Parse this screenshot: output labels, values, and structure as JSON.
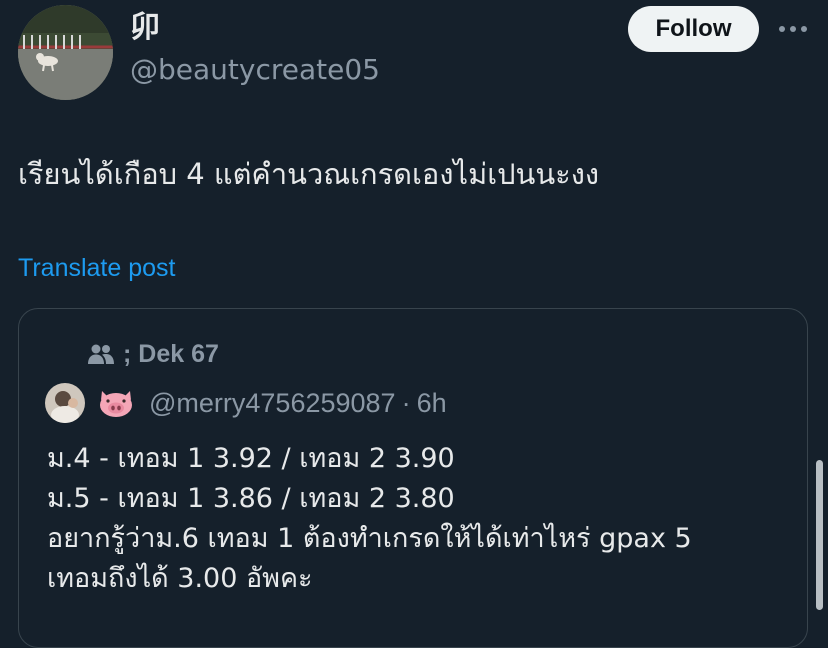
{
  "author": {
    "display_name": "卯",
    "handle": "@beautycreate05"
  },
  "actions": {
    "follow_label": "Follow",
    "more_icon": "more-horizontal-icon"
  },
  "tweet": {
    "text": "เรียนได้เกือบ 4 แต่คำนวณเกรดเองไม่เปนนะงง",
    "translate_label": "Translate post"
  },
  "quote": {
    "community": "; Dek 67",
    "community_icon": "community-people-icon",
    "badge_icon": "pig-face-icon",
    "handle": "@merry4756259087",
    "separator": "·",
    "time": "6h",
    "lines": [
      "ม.4 - เทอม 1  3.92 / เทอม 2 3.90",
      "ม.5 - เทอม 1 3.86 / เทอม 2 3.80",
      "อยากรู้ว่าม.6 เทอม 1 ต้องทำเกรดให้ได้เท่าไหร่ gpax 5",
      "เทอมถึงได้ 3.00 อัพคะ"
    ]
  },
  "colors": {
    "background": "#15202b",
    "text_primary": "#e7e9ea",
    "text_secondary": "#8b98a5",
    "link": "#1d9bf0",
    "border": "#38444d",
    "pig": "#f4a6b7"
  }
}
